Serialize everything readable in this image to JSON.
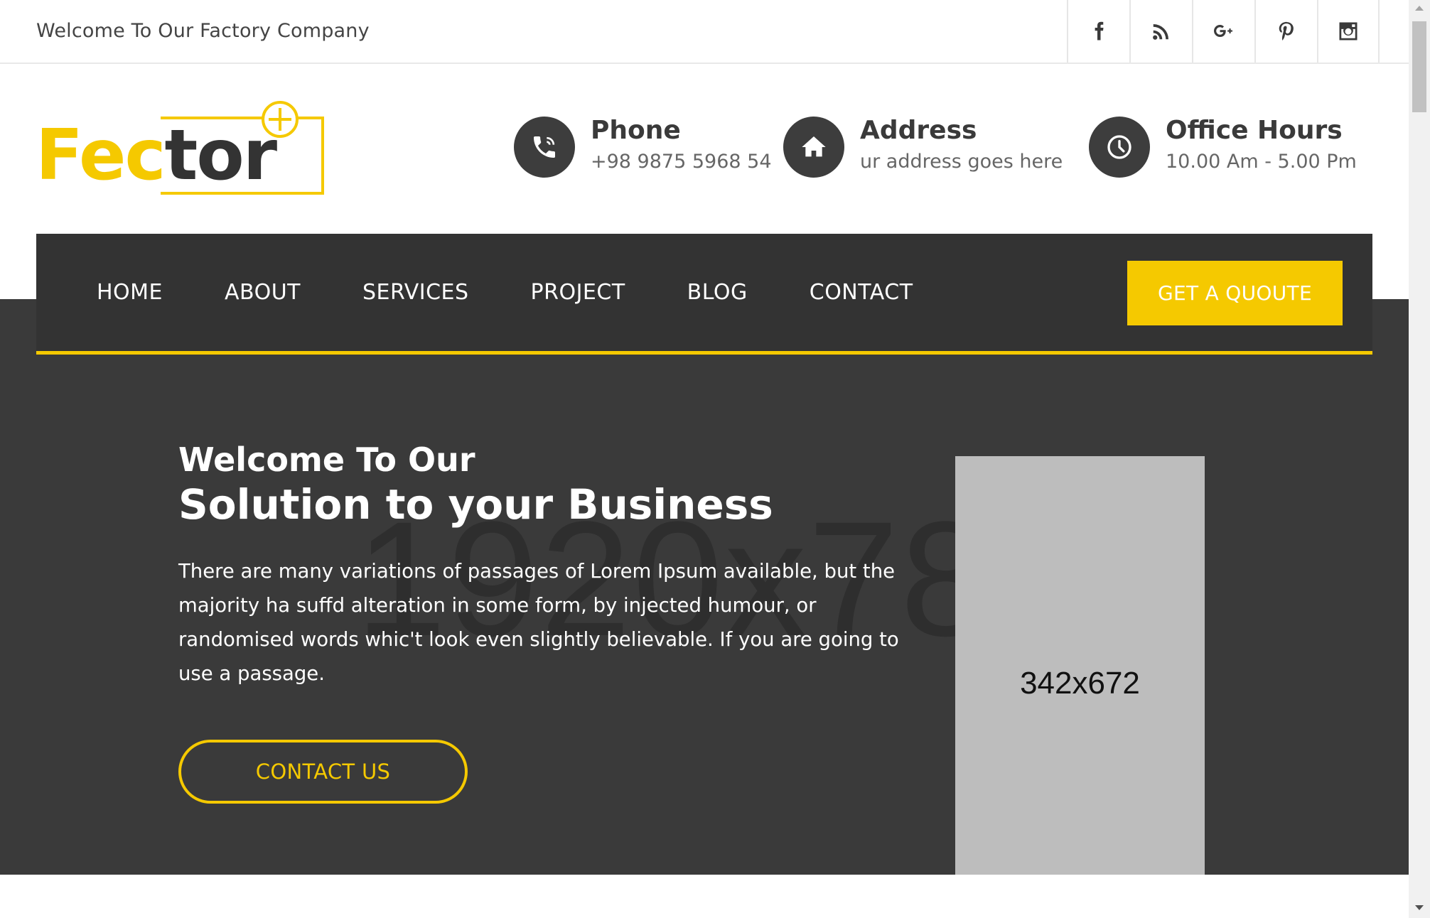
{
  "topbar": {
    "welcome": "Welcome To Our Factory Company",
    "socials": [
      {
        "icon": "facebook-icon"
      },
      {
        "icon": "rss-icon"
      },
      {
        "icon": "google-plus-icon"
      },
      {
        "icon": "pinterest-icon"
      },
      {
        "icon": "instagram-icon"
      }
    ]
  },
  "logo": {
    "part1": "Fec",
    "part2": "tor"
  },
  "contact_info": {
    "phone": {
      "title": "Phone",
      "value": "+98 9875 5968 54"
    },
    "address": {
      "title": "Address",
      "value": "ur address goes here"
    },
    "hours": {
      "title": "Office Hours",
      "value": "10.00 Am - 5.00 Pm"
    }
  },
  "nav": {
    "items": [
      "HOME",
      "ABOUT",
      "SERVICES",
      "PROJECT",
      "BLOG",
      "CONTACT"
    ],
    "quote_label": "GET A QUOUTE"
  },
  "hero": {
    "watermark": "1920x78",
    "pretitle": "Welcome To Our",
    "title": "Solution to your Business",
    "description": "There are many variations of passages of Lorem Ipsum available, but the majority ha suffd alteration in some form, by injected humour, or randomised words whic't look even slightly believable. If you are going to use a passage.",
    "button_label": "CONTACT US",
    "image_placeholder": "342x672"
  },
  "colors": {
    "accent": "#f5c900",
    "dark": "#3a3a3a",
    "nav_bg": "#333333"
  }
}
